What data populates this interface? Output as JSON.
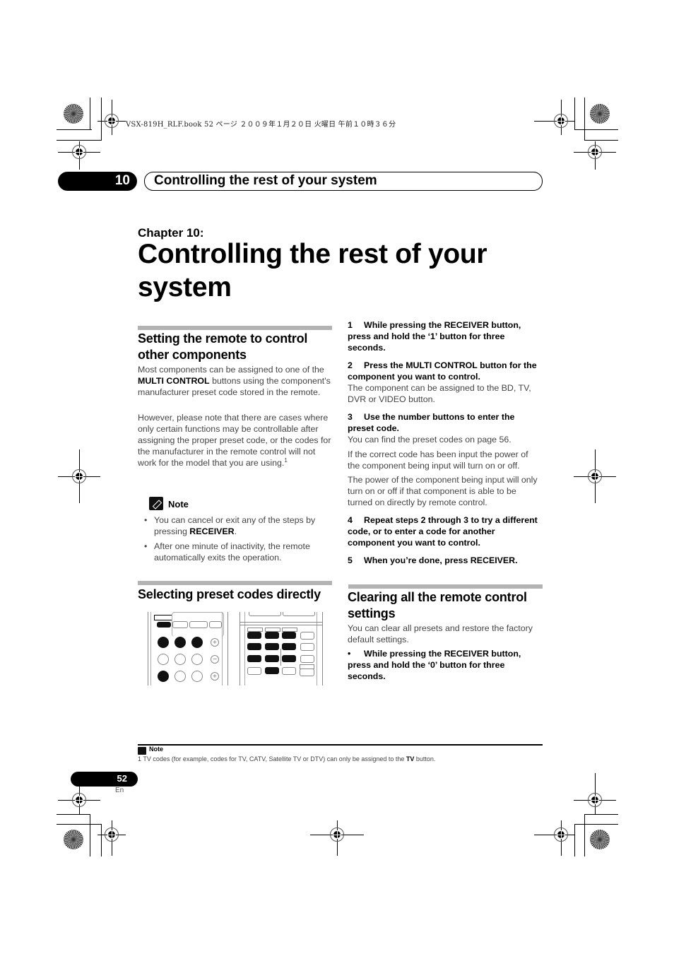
{
  "print_header": {
    "text": "VSX-819H_RLF.book   52 ページ   ２００９年１月２０日   火曜日   午前１０時３６分"
  },
  "chapter_tab": {
    "number": "10",
    "title": "Controlling the rest of your system"
  },
  "chapter": {
    "label": "Chapter 10:",
    "title": "Controlling the rest of your system"
  },
  "section_setting": {
    "heading": "Setting the remote to control other components",
    "para1_pre": "Most components can be assigned to one of the ",
    "para1_bold": "MULTI CONTROL",
    "para1_post": " buttons using the component's manufacturer preset code stored in the remote.",
    "para2": "However, please note that there are cases where only certain functions may be controllable after assigning the proper preset code, or the codes for the manufacturer in the remote control will not work for the model that you are using.",
    "para2_footnote_ref": "1"
  },
  "note": {
    "label": "Note",
    "bullets": [
      {
        "pre": "You can cancel or exit any of the steps by pressing ",
        "bold": "RECEIVER",
        "post": "."
      },
      {
        "pre": "After one minute of inactivity, the remote automatically exits the operation.",
        "bold": "",
        "post": ""
      }
    ]
  },
  "section_selecting": {
    "heading": "Selecting preset codes directly"
  },
  "steps": [
    {
      "num": "1",
      "text": "While pressing the RECEIVER button, press and hold the ‘1’ button for three seconds.",
      "details": []
    },
    {
      "num": "2",
      "text": "Press the MULTI CONTROL button for the component you want to control.",
      "details": [
        "The component can be assigned to the BD, TV, DVR or VIDEO button."
      ]
    },
    {
      "num": "3",
      "text": "Use the number buttons to enter the preset code.",
      "details": [
        "You can find the preset codes on page 56.",
        "If the correct code has been input the power of the component being input will turn on or off.",
        "The power of the component being input will only turn on or off if that component is able to be turned on directly by remote control."
      ]
    },
    {
      "num": "4",
      "text": "Repeat steps 2 through 3 to try a different code, or to enter a code for another component you want to control.",
      "details": []
    },
    {
      "num": "5",
      "text": "When you’re done, press RECEIVER.",
      "details": []
    }
  ],
  "section_clearing": {
    "heading": "Clearing all the remote control settings",
    "para": "You can clear all presets and restore the factory default settings.",
    "bullet_marker": "•",
    "bullet_step": "While pressing the RECEIVER button, press and hold the ‘0’ button for three seconds."
  },
  "footnote": {
    "label": "Note",
    "number": "1",
    "text_pre": "TV codes (for example, codes for TV, CATV, Satellite TV or DTV) can only be assigned to the ",
    "text_bold": "TV",
    "text_post": " button."
  },
  "page": {
    "number": "52",
    "language": "En"
  },
  "colors": {
    "section_bar": "#b3b3b3",
    "body_text": "#444444"
  }
}
